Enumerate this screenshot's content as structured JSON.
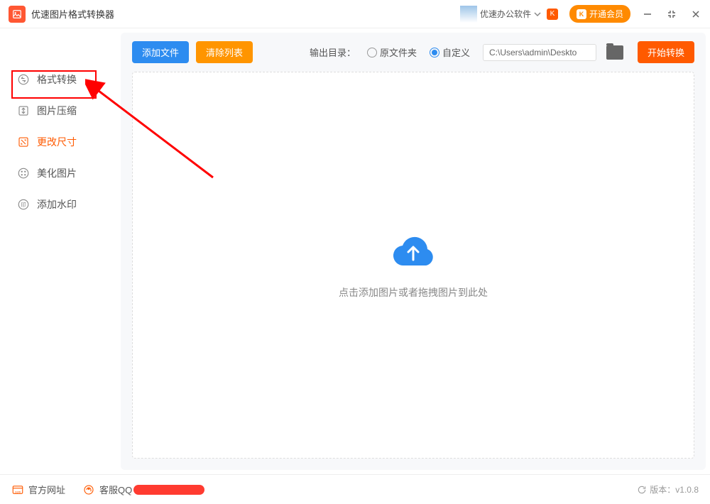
{
  "titlebar": {
    "app_name": "优速图片格式转换器",
    "user_label": "优速办公软件",
    "vip_button": "开通会员"
  },
  "sidebar": {
    "items": [
      {
        "label": "格式转换",
        "icon": "convert-icon"
      },
      {
        "label": "图片压缩",
        "icon": "compress-icon"
      },
      {
        "label": "更改尺寸",
        "icon": "resize-icon"
      },
      {
        "label": "美化图片",
        "icon": "beautify-icon"
      },
      {
        "label": "添加水印",
        "icon": "watermark-icon"
      }
    ]
  },
  "toolbar": {
    "add_file": "添加文件",
    "clear_list": "清除列表",
    "output_label": "输出目录：",
    "radio_original": "原文件夹",
    "radio_custom": "自定义",
    "path_value": "C:\\Users\\admin\\Deskto",
    "start_convert": "开始转换"
  },
  "drop_area": {
    "hint": "点击添加图片或者拖拽图片到此处"
  },
  "statusbar": {
    "official_site": "官方网址",
    "support_prefix": "客服QQ",
    "version_label": "版本：",
    "version_value": "v1.0.8"
  }
}
